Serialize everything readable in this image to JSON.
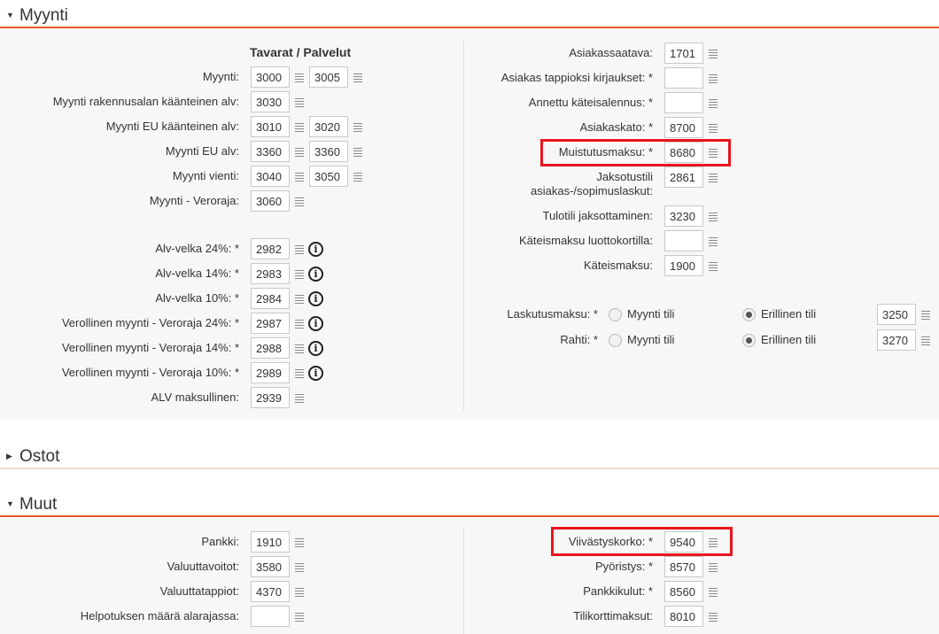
{
  "sections": {
    "myynti": {
      "title": "Myynti"
    },
    "ostot": {
      "title": "Ostot"
    },
    "muut": {
      "title": "Muut"
    }
  },
  "myynti": {
    "column_header": "Tavarat / Palvelut",
    "left": [
      {
        "label": "Myynti:",
        "value1": "3000",
        "value2": "3005"
      },
      {
        "label": "Myynti rakennusalan käänteinen alv:",
        "value1": "3030"
      },
      {
        "label": "Myynti EU käänteinen alv:",
        "value1": "3010",
        "value2": "3020"
      },
      {
        "label": "Myynti EU alv:",
        "value1": "3360",
        "value2": "3360"
      },
      {
        "label": "Myynti vienti:",
        "value1": "3040",
        "value2": "3050"
      },
      {
        "label": "Myynti - Veroraja:",
        "value1": "3060"
      }
    ],
    "vat": [
      {
        "label": "Alv-velka 24%: *",
        "value": "2982"
      },
      {
        "label": "Alv-velka 14%: *",
        "value": "2983"
      },
      {
        "label": "Alv-velka 10%: *",
        "value": "2984"
      },
      {
        "label": "Verollinen myynti - Veroraja 24%: *",
        "value": "2987"
      },
      {
        "label": "Verollinen myynti - Veroraja 14%: *",
        "value": "2988"
      },
      {
        "label": "Verollinen myynti - Veroraja 10%: *",
        "value": "2989"
      }
    ],
    "alv_maksullinen": {
      "label": "ALV maksullinen:",
      "value": "2939"
    },
    "right": [
      {
        "label": "Asiakassaatava:",
        "value": "1701"
      },
      {
        "label": "Asiakas tappioksi kirjaukset: *",
        "value": ""
      },
      {
        "label": "Annettu käteisalennus: *",
        "value": ""
      },
      {
        "label": "Asiakaskato: *",
        "value": "8700"
      },
      {
        "label": "Muistutusmaksu: *",
        "value": "8680"
      },
      {
        "label": "Jaksotustili asiakas-/sopimuslaskut:",
        "value": "2861"
      },
      {
        "label": "Tulotili jaksottaminen:",
        "value": "3230"
      },
      {
        "label": "Käteismaksu luottokortilla:",
        "value": ""
      },
      {
        "label": "Käteismaksu:",
        "value": "1900"
      }
    ],
    "radio_rows": [
      {
        "label": "Laskutusmaksu: *",
        "option1": "Myynti tili",
        "option2": "Erillinen tili",
        "value": "3250"
      },
      {
        "label": "Rahti: *",
        "option1": "Myynti tili",
        "option2": "Erillinen tili",
        "value": "3270"
      }
    ]
  },
  "muut": {
    "left": [
      {
        "label": "Pankki:",
        "value": "1910"
      },
      {
        "label": "Valuuttavoitot:",
        "value": "3580"
      },
      {
        "label": "Valuuttatappiot:",
        "value": "4370"
      },
      {
        "label": "Helpotuksen määrä alarajassa:",
        "value": ""
      }
    ],
    "right": [
      {
        "label": "Viivästyskorko: *",
        "value": "9540"
      },
      {
        "label": "Pyöristys: *",
        "value": "8570"
      },
      {
        "label": "Pankkikulut: *",
        "value": "8560"
      },
      {
        "label": "Tilikorttimaksut:",
        "value": "8010"
      }
    ]
  },
  "colors": {
    "accent": "#e85a22",
    "highlight": "#e8141c"
  }
}
